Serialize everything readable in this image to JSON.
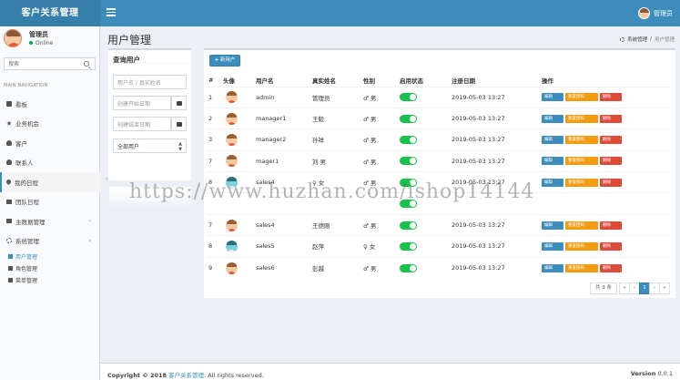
{
  "header": {
    "logo": "客户关系管理",
    "user": "管理员"
  },
  "sidebar": {
    "user": {
      "name": "管理员",
      "status": "Online"
    },
    "search_placeholder": "搜索",
    "nav_header": "MAIN NAVIGATION",
    "items": [
      {
        "label": "看板",
        "icon": "dashboard-icon"
      },
      {
        "label": "业务机会",
        "icon": "star-icon"
      },
      {
        "label": "客户",
        "icon": "user-icon"
      },
      {
        "label": "联系人",
        "icon": "users-icon"
      },
      {
        "label": "我的日程",
        "icon": "pin-icon"
      },
      {
        "label": "团队日程",
        "icon": "list-icon"
      },
      {
        "label": "主数据管理",
        "icon": "list-icon"
      },
      {
        "label": "系统管理",
        "icon": "gear-icon"
      }
    ],
    "sub_items": [
      {
        "label": "用户管理",
        "icon": "user-icon"
      },
      {
        "label": "角色管理",
        "icon": "users-icon"
      },
      {
        "label": "菜单管理",
        "icon": "list-icon"
      }
    ]
  },
  "page": {
    "title": "用户管理",
    "breadcrumb": {
      "root": "系统管理",
      "sep": "/",
      "current": "用户管理"
    }
  },
  "query": {
    "title": "查询用户",
    "name_placeholder": "用户名 / 真实姓名",
    "start_placeholder": "创建开始日期",
    "end_placeholder": "创建结束日期",
    "select_value": "全部用户"
  },
  "table": {
    "add_button": "新用户",
    "headers": [
      "#",
      "头像",
      "用户名",
      "真实姓名",
      "性别",
      "启用状态",
      "注册日期",
      "操作"
    ],
    "rows": [
      {
        "no": "1",
        "username": "admin",
        "realname": "管理员",
        "gender": "♂ 男",
        "date": "2019-05-03 13:27",
        "avatar": "normal"
      },
      {
        "no": "2",
        "username": "manager1",
        "realname": "王毅",
        "gender": "♂ 男",
        "date": "2019-05-03 13:27",
        "avatar": "normal"
      },
      {
        "no": "3",
        "username": "manager2",
        "realname": "孙祥",
        "gender": "♂ 男",
        "date": "2019-05-03 13:27",
        "avatar": "normal"
      },
      {
        "no": "7",
        "username": "mager1",
        "realname": "刘 男",
        "gender": "♂ 男",
        "date": "2019-05-03 13:27",
        "avatar": "normal"
      },
      {
        "no": "8",
        "username": "sales4",
        "realname": "♀ 女",
        "gender": "♂ 男",
        "date": "2019-05-03 13:27",
        "avatar": "teal"
      },
      {
        "no": "",
        "username": "",
        "realname": "",
        "gender": "",
        "date": "",
        "avatar": "none"
      },
      {
        "no": "7",
        "username": "sales4",
        "realname": "王德刚",
        "gender": "♂ 男",
        "date": "2019-05-03 13:27",
        "avatar": "normal"
      },
      {
        "no": "8",
        "username": "sales5",
        "realname": "赵萍",
        "gender": "♀ 女",
        "date": "2019-05-03 13:27",
        "avatar": "teal"
      },
      {
        "no": "9",
        "username": "sales6",
        "realname": "彭越",
        "gender": "♂ 男",
        "date": "2019-05-03 13:27",
        "avatar": "normal"
      }
    ],
    "ops": {
      "edit": "编辑",
      "reset": "重置密码",
      "delete": "删除"
    }
  },
  "pager": {
    "total": "共 9 条",
    "first": "«",
    "prev": "‹",
    "page": "1",
    "next": "›",
    "last": "»"
  },
  "footer": {
    "copyright": "Copyright © 2018",
    "brand": "客户关系管理",
    "rights": ". All rights reserved.",
    "version_label": "Version",
    "version": "0.0.1"
  },
  "watermark": "https://www.huzhan.com/ishop14144"
}
